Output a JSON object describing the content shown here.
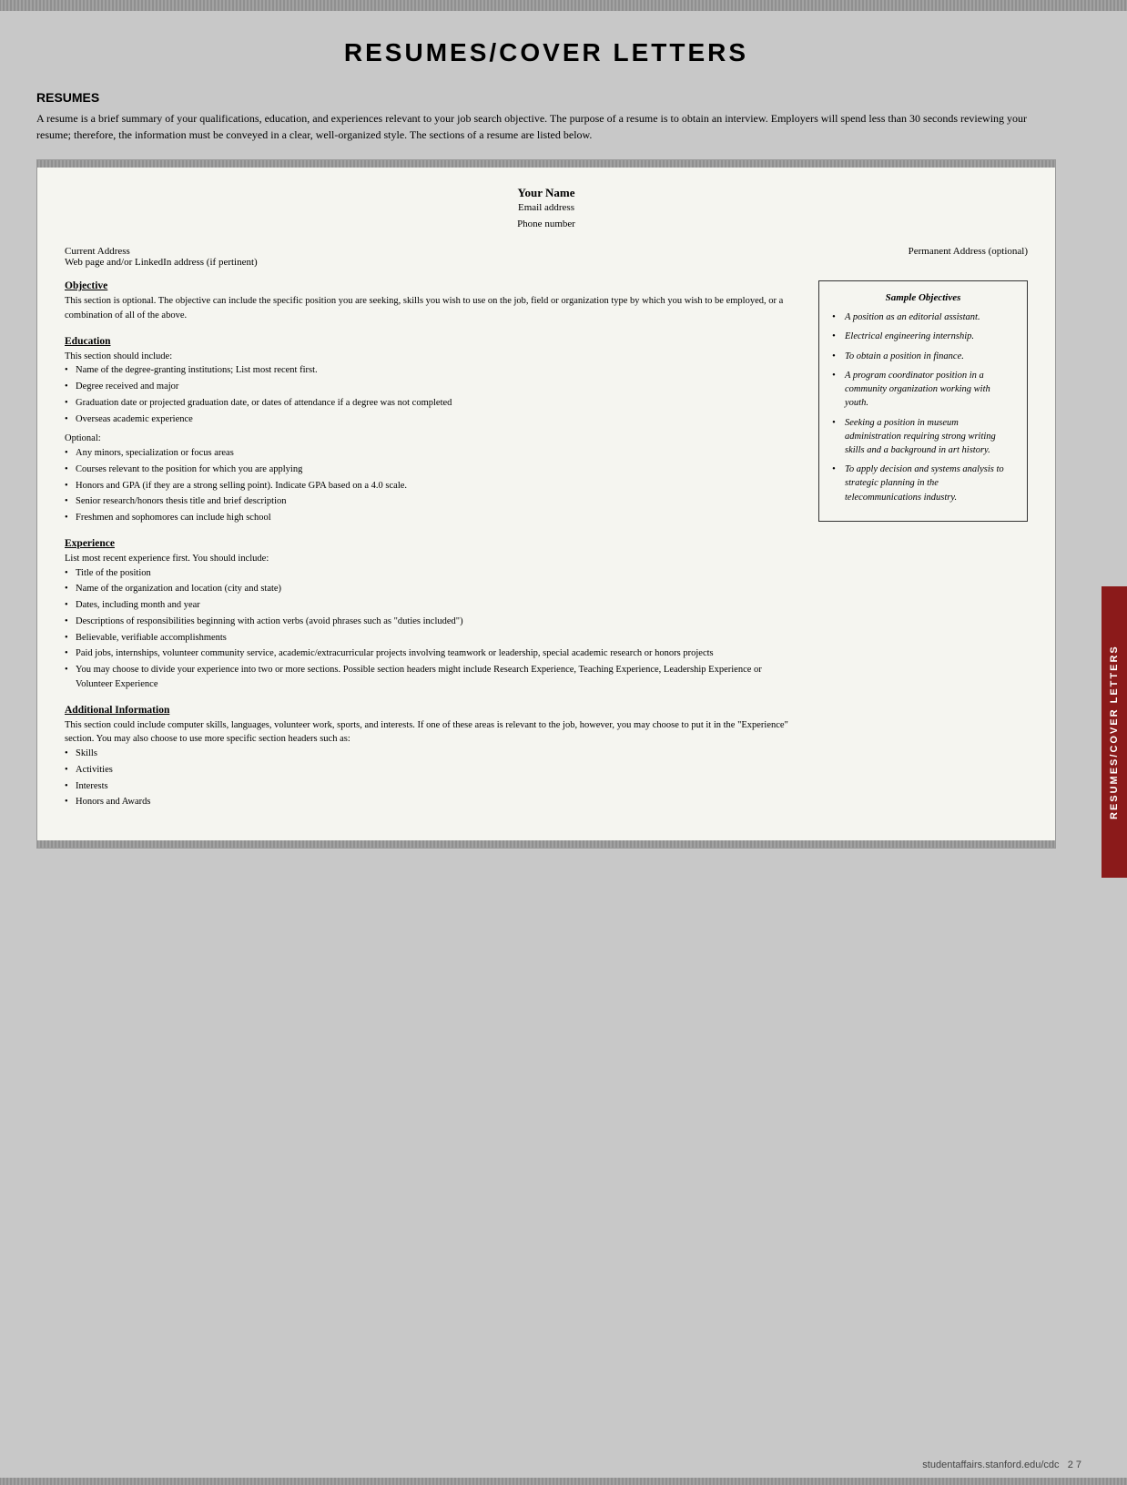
{
  "page": {
    "title": "RESUMES/COVER LETTERS",
    "footer_url": "studentaffairs.stanford.edu/cdc",
    "footer_page": "2  7"
  },
  "right_tab": {
    "label": "RESUMES/COVER LETTERS"
  },
  "resumes_section": {
    "heading": "RESUMES",
    "intro": "A resume is a brief summary of your qualifications, education, and experiences relevant to your job search objective. The purpose of a resume is to obtain an interview. Employers will spend less than 30 seconds reviewing your resume; therefore, the information must be conveyed in a clear, well-organized style. The sections of a resume are listed below."
  },
  "resume_template": {
    "name": "Your Name",
    "email": "Email address",
    "phone": "Phone number",
    "current_address_label": "Current Address",
    "current_address_detail": "Web page and/or LinkedIn address (if pertinent)",
    "permanent_address_label": "Permanent Address (optional)",
    "sections": {
      "objective": {
        "title": "Objective",
        "text": "This section is optional. The objective can include the specific position you are seeking, skills you wish to use on the job, field or organization type by which you wish to be employed, or a combination of all of the above."
      },
      "education": {
        "title": "Education",
        "intro": "This section should include:",
        "items": [
          "Name of the degree-granting institutions; List most recent first.",
          "Degree received and major",
          "Graduation date or projected graduation date, or dates of attendance if a degree was not completed",
          "Overseas academic experience"
        ],
        "optional_label": "Optional:",
        "optional_items": [
          "Any minors, specialization or focus areas",
          "Courses relevant to the position for which you are applying",
          "Honors and GPA (if they are a strong selling point). Indicate GPA based on a 4.0 scale.",
          "Senior research/honors thesis title and brief description",
          "Freshmen and sophomores can include high school"
        ]
      },
      "experience": {
        "title": "Experience",
        "intro": "List most recent experience first. You should include:",
        "items": [
          "Title of the position",
          "Name of the organization and location (city and state)",
          "Dates, including month and year",
          "Descriptions of responsibilities beginning with action verbs (avoid phrases such as \"duties included\")",
          "Believable, verifiable accomplishments",
          "Paid jobs, internships, volunteer community service, academic/extracurricular projects involving teamwork or leadership, special academic research or honors projects",
          "You may choose to divide your experience into two or more sections. Possible section headers might include Research Experience, Teaching Experience, Leadership Experience or Volunteer Experience"
        ]
      },
      "additional_info": {
        "title": "Additional Information",
        "text": "This section could include computer skills, languages, volunteer work, sports, and interests. If one of these areas is relevant to the job, however, you may choose to put it in the \"Experience\" section. You may also choose to use more specific section headers such as:",
        "items": [
          "Skills",
          "Activities",
          "Interests",
          "Honors and Awards"
        ]
      }
    }
  },
  "sample_objectives": {
    "title": "Sample Objectives",
    "items": [
      "A position as an editorial assistant.",
      "Electrical engineering internship.",
      "To obtain a position in finance.",
      "A program coordinator position in a community organization working with youth.",
      "Seeking a position in museum administration requiring strong writing skills and a background in art history.",
      "To apply decision and systems analysis to strategic planning in the telecommunications industry."
    ]
  }
}
